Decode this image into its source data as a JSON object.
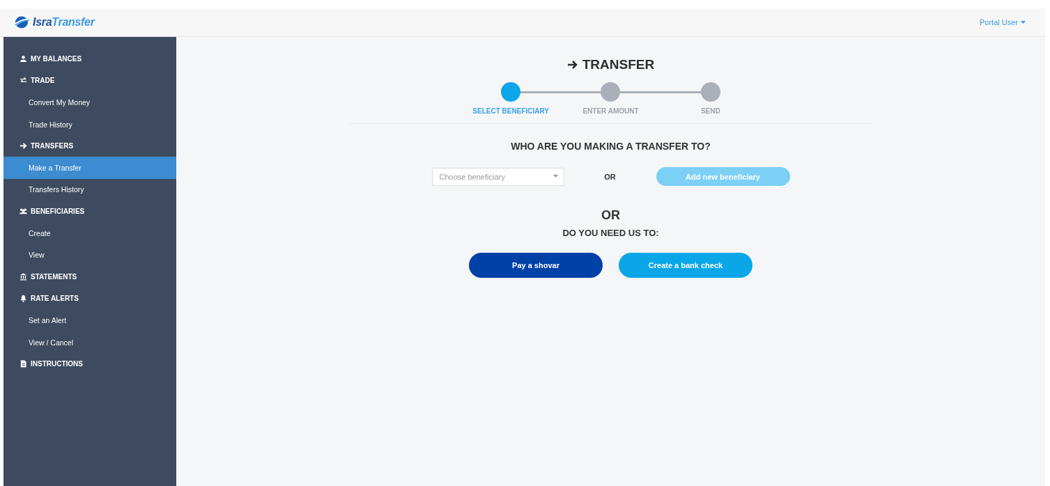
{
  "header": {
    "logo": "**Isra**Transfer",
    "user_menu": "Portal User"
  },
  "sidebar": {
    "items": [
      {
        "kind": "section",
        "label": "MY BALANCES",
        "selected": false
      },
      {
        "kind": "section",
        "label": "TRADE",
        "selected": false
      },
      {
        "kind": "sub",
        "label": "Convert My Money",
        "selected": false
      },
      {
        "kind": "sub",
        "label": "Trade History",
        "selected": false
      },
      {
        "kind": "section",
        "label": "TRANSFERS",
        "selected": false
      },
      {
        "kind": "sub",
        "label": "Make a Transfer",
        "selected": true
      },
      {
        "kind": "sub",
        "label": "Transfers History",
        "selected": false
      },
      {
        "kind": "section",
        "label": "BENEFICIARIES",
        "selected": false
      },
      {
        "kind": "sub",
        "label": "Create",
        "selected": false
      },
      {
        "kind": "sub",
        "label": "View",
        "selected": false
      },
      {
        "kind": "section",
        "label": "STATEMENTS",
        "selected": false
      },
      {
        "kind": "section",
        "label": "RATE ALERTS",
        "selected": false
      },
      {
        "kind": "sub",
        "label": "Set an Alert",
        "selected": false
      },
      {
        "kind": "sub",
        "label": "View / Cancel",
        "selected": false
      },
      {
        "kind": "section",
        "label": "INSTRUCTIONS",
        "selected": false
      }
    ]
  },
  "page": {
    "title": "TRANSFER",
    "steps": [
      {
        "label": "SELECT BENEFICIARY",
        "selected": true
      },
      {
        "label": "ENTER AMOUNT",
        "selected": false
      },
      {
        "label": "SEND",
        "selected": false
      }
    ],
    "question": "WHO ARE YOU MAKING A TRANSFER TO?",
    "beneficiary_select": {
      "placeholder": "Choose beneficiary"
    },
    "or_small": "OR",
    "add_button": {
      "label": "Add new beneficiary",
      "disabled": true
    },
    "or_large": "OR",
    "subquestion": "DO YOU NEED US TO:",
    "actions": [
      {
        "label": "Pay a shovar",
        "kind": "primary"
      },
      {
        "label": "Create a bank check",
        "kind": "secondary"
      }
    ]
  }
}
